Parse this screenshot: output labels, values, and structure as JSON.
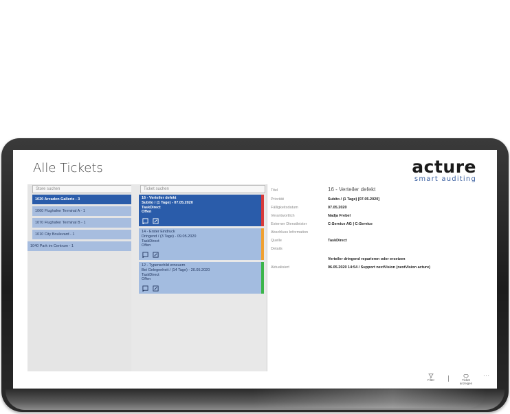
{
  "page_title": "Alle Tickets",
  "logo": {
    "main": "acture",
    "sub": "smart auditing"
  },
  "stores": {
    "search_placeholder": "Store suchen",
    "items": [
      {
        "label": "1020 Arcaden Gallerie - 3",
        "active": true
      },
      {
        "label": "1060 Flughafen Terminal A - 1",
        "active": false
      },
      {
        "label": "1070 Flughafen Terminal B - 1",
        "active": false
      },
      {
        "label": "1010 City Boulevard - 1",
        "active": false
      },
      {
        "label": "1040 Park im Centrum - 1",
        "active": false
      }
    ]
  },
  "tickets": {
    "search_placeholder": "Ticket suchen",
    "items": [
      {
        "title": "16 - Verteiler defekt",
        "priority": "Subito / (1 Tage) - 07.05.2020",
        "assignee": "TaskDirect",
        "status": "Offen",
        "bar_color": "#d83a3a",
        "active": true
      },
      {
        "title": "14 - Erster Eindruck",
        "priority": "Dringend / (3 Tage) - 09.05.2020",
        "assignee": "TaskDirect",
        "status": "Offen",
        "bar_color": "#f0a030",
        "active": false
      },
      {
        "title": "12 - Typenschild erneuern",
        "priority": "Bei Gelegenheit / (14 Tage) - 20.05.2020",
        "assignee": "TaskDirect",
        "status": "Offen",
        "bar_color": "#3bb54a",
        "active": false
      }
    ]
  },
  "details": {
    "title_label": "Titel",
    "title_value": "16 - Verteiler defekt",
    "fields": [
      {
        "label": "Priorität",
        "value": "Subito / (1 Tage) [07.05.2020]"
      },
      {
        "label": "Fälligkeitsdatum",
        "value": "07.05.2020"
      },
      {
        "label": "Verantwortlich",
        "value": "Nadja Frebel"
      },
      {
        "label": "Externer Dienstleister",
        "value": "C-Service AG | C-Service"
      },
      {
        "label": "Abschluss Information",
        "value": ""
      },
      {
        "label": "Quelle",
        "value": "TaskDirect"
      },
      {
        "label": "Details",
        "value": ""
      }
    ],
    "details_text": "Verteiler dringend reparieren oder ersetzen",
    "updated_label": "Aktualisiert",
    "updated_value": "06.05.2020 14:54 / Support nextVision (nextVision acture)"
  },
  "command_bar": {
    "filter_label": "Filter",
    "ticket_label_1": "Ticket",
    "ticket_label_2": "anzeigen",
    "more_label": "···"
  },
  "colors": {
    "accent": "#2a5caa",
    "item_bg": "#a7bddf",
    "urgent": "#d83a3a",
    "medium": "#f0a030",
    "low": "#3bb54a"
  }
}
